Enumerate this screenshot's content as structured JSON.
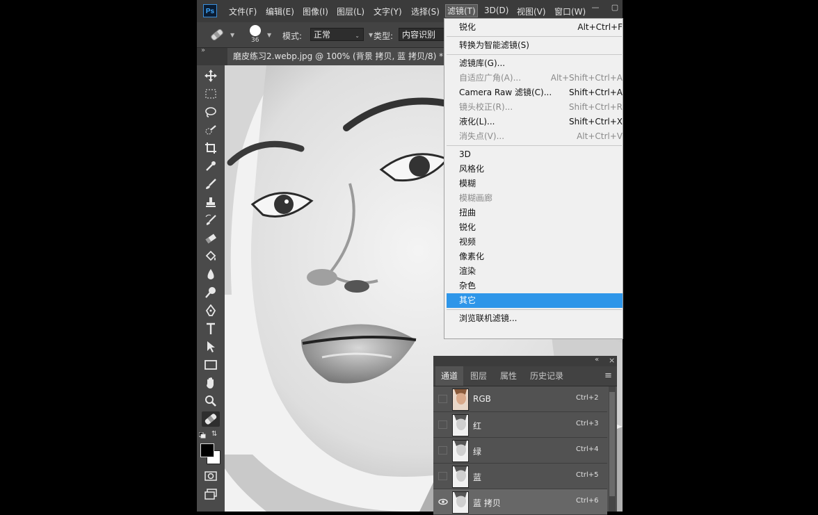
{
  "app": {
    "logo": "Ps",
    "menu": [
      "文件(F)",
      "编辑(E)",
      "图像(I)",
      "图层(L)",
      "文字(Y)",
      "选择(S)",
      "滤镜(T)",
      "3D(D)",
      "视图(V)",
      "窗口(W)"
    ],
    "active_menu": "滤镜(T)"
  },
  "options": {
    "brush_size": "36",
    "mode_label": "模式:",
    "mode_value": "正常",
    "type_label": "类型:",
    "type_value": "内容识别"
  },
  "document": {
    "tab_title": "磨皮练习2.webp.jpg @ 100% (背景 拷贝, 蓝 拷贝/8) *",
    "close": "×",
    "collapse": "»"
  },
  "filter_menu": {
    "items": [
      {
        "label": "锐化",
        "shortcut": "Alt+Ctrl+F",
        "disabled": false
      },
      {
        "sep": true
      },
      {
        "label": "转换为智能滤镜(S)",
        "shortcut": "",
        "disabled": false
      },
      {
        "sep": true
      },
      {
        "label": "滤镜库(G)...",
        "shortcut": "",
        "disabled": false
      },
      {
        "label": "自适应广角(A)...",
        "shortcut": "Alt+Shift+Ctrl+A",
        "disabled": true
      },
      {
        "label": "Camera Raw 滤镜(C)...",
        "shortcut": "Shift+Ctrl+A",
        "disabled": false
      },
      {
        "label": "镜头校正(R)...",
        "shortcut": "Shift+Ctrl+R",
        "disabled": true
      },
      {
        "label": "液化(L)...",
        "shortcut": "Shift+Ctrl+X",
        "disabled": false
      },
      {
        "label": "消失点(V)...",
        "shortcut": "Alt+Ctrl+V",
        "disabled": true
      },
      {
        "sep": true
      },
      {
        "label": "3D",
        "shortcut": "",
        "disabled": false
      },
      {
        "label": "风格化",
        "shortcut": "",
        "disabled": false
      },
      {
        "label": "模糊",
        "shortcut": "",
        "disabled": false
      },
      {
        "label": "模糊画廊",
        "shortcut": "",
        "disabled": true
      },
      {
        "label": "扭曲",
        "shortcut": "",
        "disabled": false
      },
      {
        "label": "锐化",
        "shortcut": "",
        "disabled": false
      },
      {
        "label": "视频",
        "shortcut": "",
        "disabled": false
      },
      {
        "label": "像素化",
        "shortcut": "",
        "disabled": false
      },
      {
        "label": "渲染",
        "shortcut": "",
        "disabled": false
      },
      {
        "label": "杂色",
        "shortcut": "",
        "disabled": false
      },
      {
        "label": "其它",
        "shortcut": "",
        "disabled": false,
        "highlighted": true
      },
      {
        "sep": true
      },
      {
        "label": "浏览联机滤镜...",
        "shortcut": "",
        "disabled": false
      }
    ]
  },
  "channels_panel": {
    "tabs": [
      "通道",
      "图层",
      "属性",
      "历史记录"
    ],
    "active_tab": "通道",
    "header_buttons": [
      "«",
      "×"
    ],
    "menu_icon": "≡",
    "channels": [
      {
        "name": "RGB",
        "shortcut": "Ctrl+2",
        "visible": false,
        "selected": false
      },
      {
        "name": "红",
        "shortcut": "Ctrl+3",
        "visible": false,
        "selected": false
      },
      {
        "name": "绿",
        "shortcut": "Ctrl+4",
        "visible": false,
        "selected": false
      },
      {
        "name": "蓝",
        "shortcut": "Ctrl+5",
        "visible": false,
        "selected": false
      },
      {
        "name": "蓝 拷贝",
        "shortcut": "Ctrl+6",
        "visible": true,
        "selected": true
      }
    ]
  },
  "colors": {
    "foreground": "#000000",
    "background": "#ffffff",
    "menu_highlight": "#2e96e9"
  }
}
